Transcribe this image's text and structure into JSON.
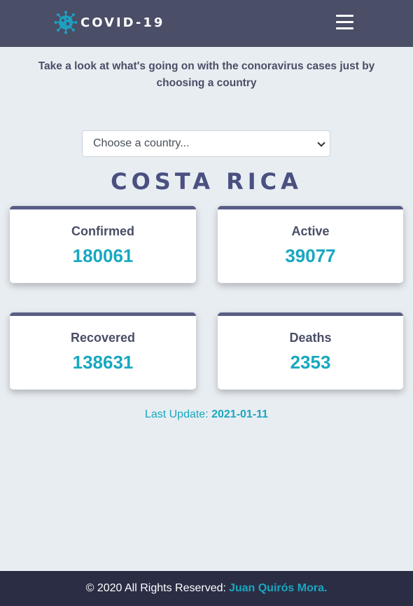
{
  "navbar": {
    "brand_icon": "coronavirus-icon",
    "brand_text": "COVID-19",
    "menu_icon": "hamburger-icon"
  },
  "intro": {
    "text": "Take a look at what's going on with the conoravirus cases just by choosing a country"
  },
  "selector": {
    "placeholder": "Choose a country..."
  },
  "country": {
    "name": "COSTA RICA"
  },
  "stats": [
    {
      "label": "Confirmed",
      "value": "180061"
    },
    {
      "label": "Active",
      "value": "39077"
    },
    {
      "label": "Recovered",
      "value": "138631"
    },
    {
      "label": "Deaths",
      "value": "2353"
    }
  ],
  "update": {
    "label": "Last Update:",
    "date": "2021-01-11"
  },
  "footer": {
    "text": "© 2020 All Rights Reserved:",
    "author": "Juan Quirós Mora."
  },
  "colors": {
    "navbar": "#4a4e66",
    "accent": "#17a8bf",
    "card_top": "#5a5e86",
    "footer": "#2b2d45",
    "background": "#e8edf2"
  }
}
